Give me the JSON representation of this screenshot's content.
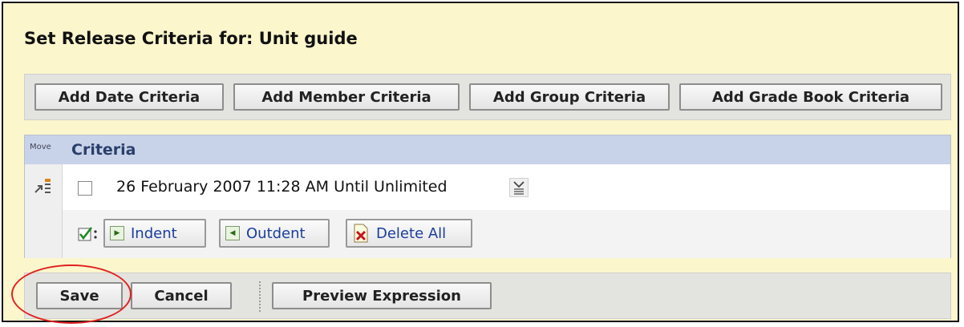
{
  "title": "Set Release Criteria for: Unit guide",
  "toolbar": {
    "add_date": "Add Date Criteria",
    "add_member": "Add Member Criteria",
    "add_group": "Add Group Criteria",
    "add_gradebook": "Add Grade Book Criteria"
  },
  "criteria": {
    "move_label": "Move",
    "header": "Criteria",
    "rows": [
      {
        "text": "26 February 2007 11:28 AM Until Unlimited",
        "checked": false
      }
    ],
    "actions": {
      "indent": "Indent",
      "outdent": "Outdent",
      "delete_all": "Delete All"
    }
  },
  "footer": {
    "save": "Save",
    "cancel": "Cancel",
    "preview": "Preview Expression"
  },
  "colors": {
    "panel_bg": "#fbf6cc",
    "header_bg": "#c8d3ea",
    "link_blue": "#1b3e9e",
    "annotation_red": "#e12020"
  }
}
